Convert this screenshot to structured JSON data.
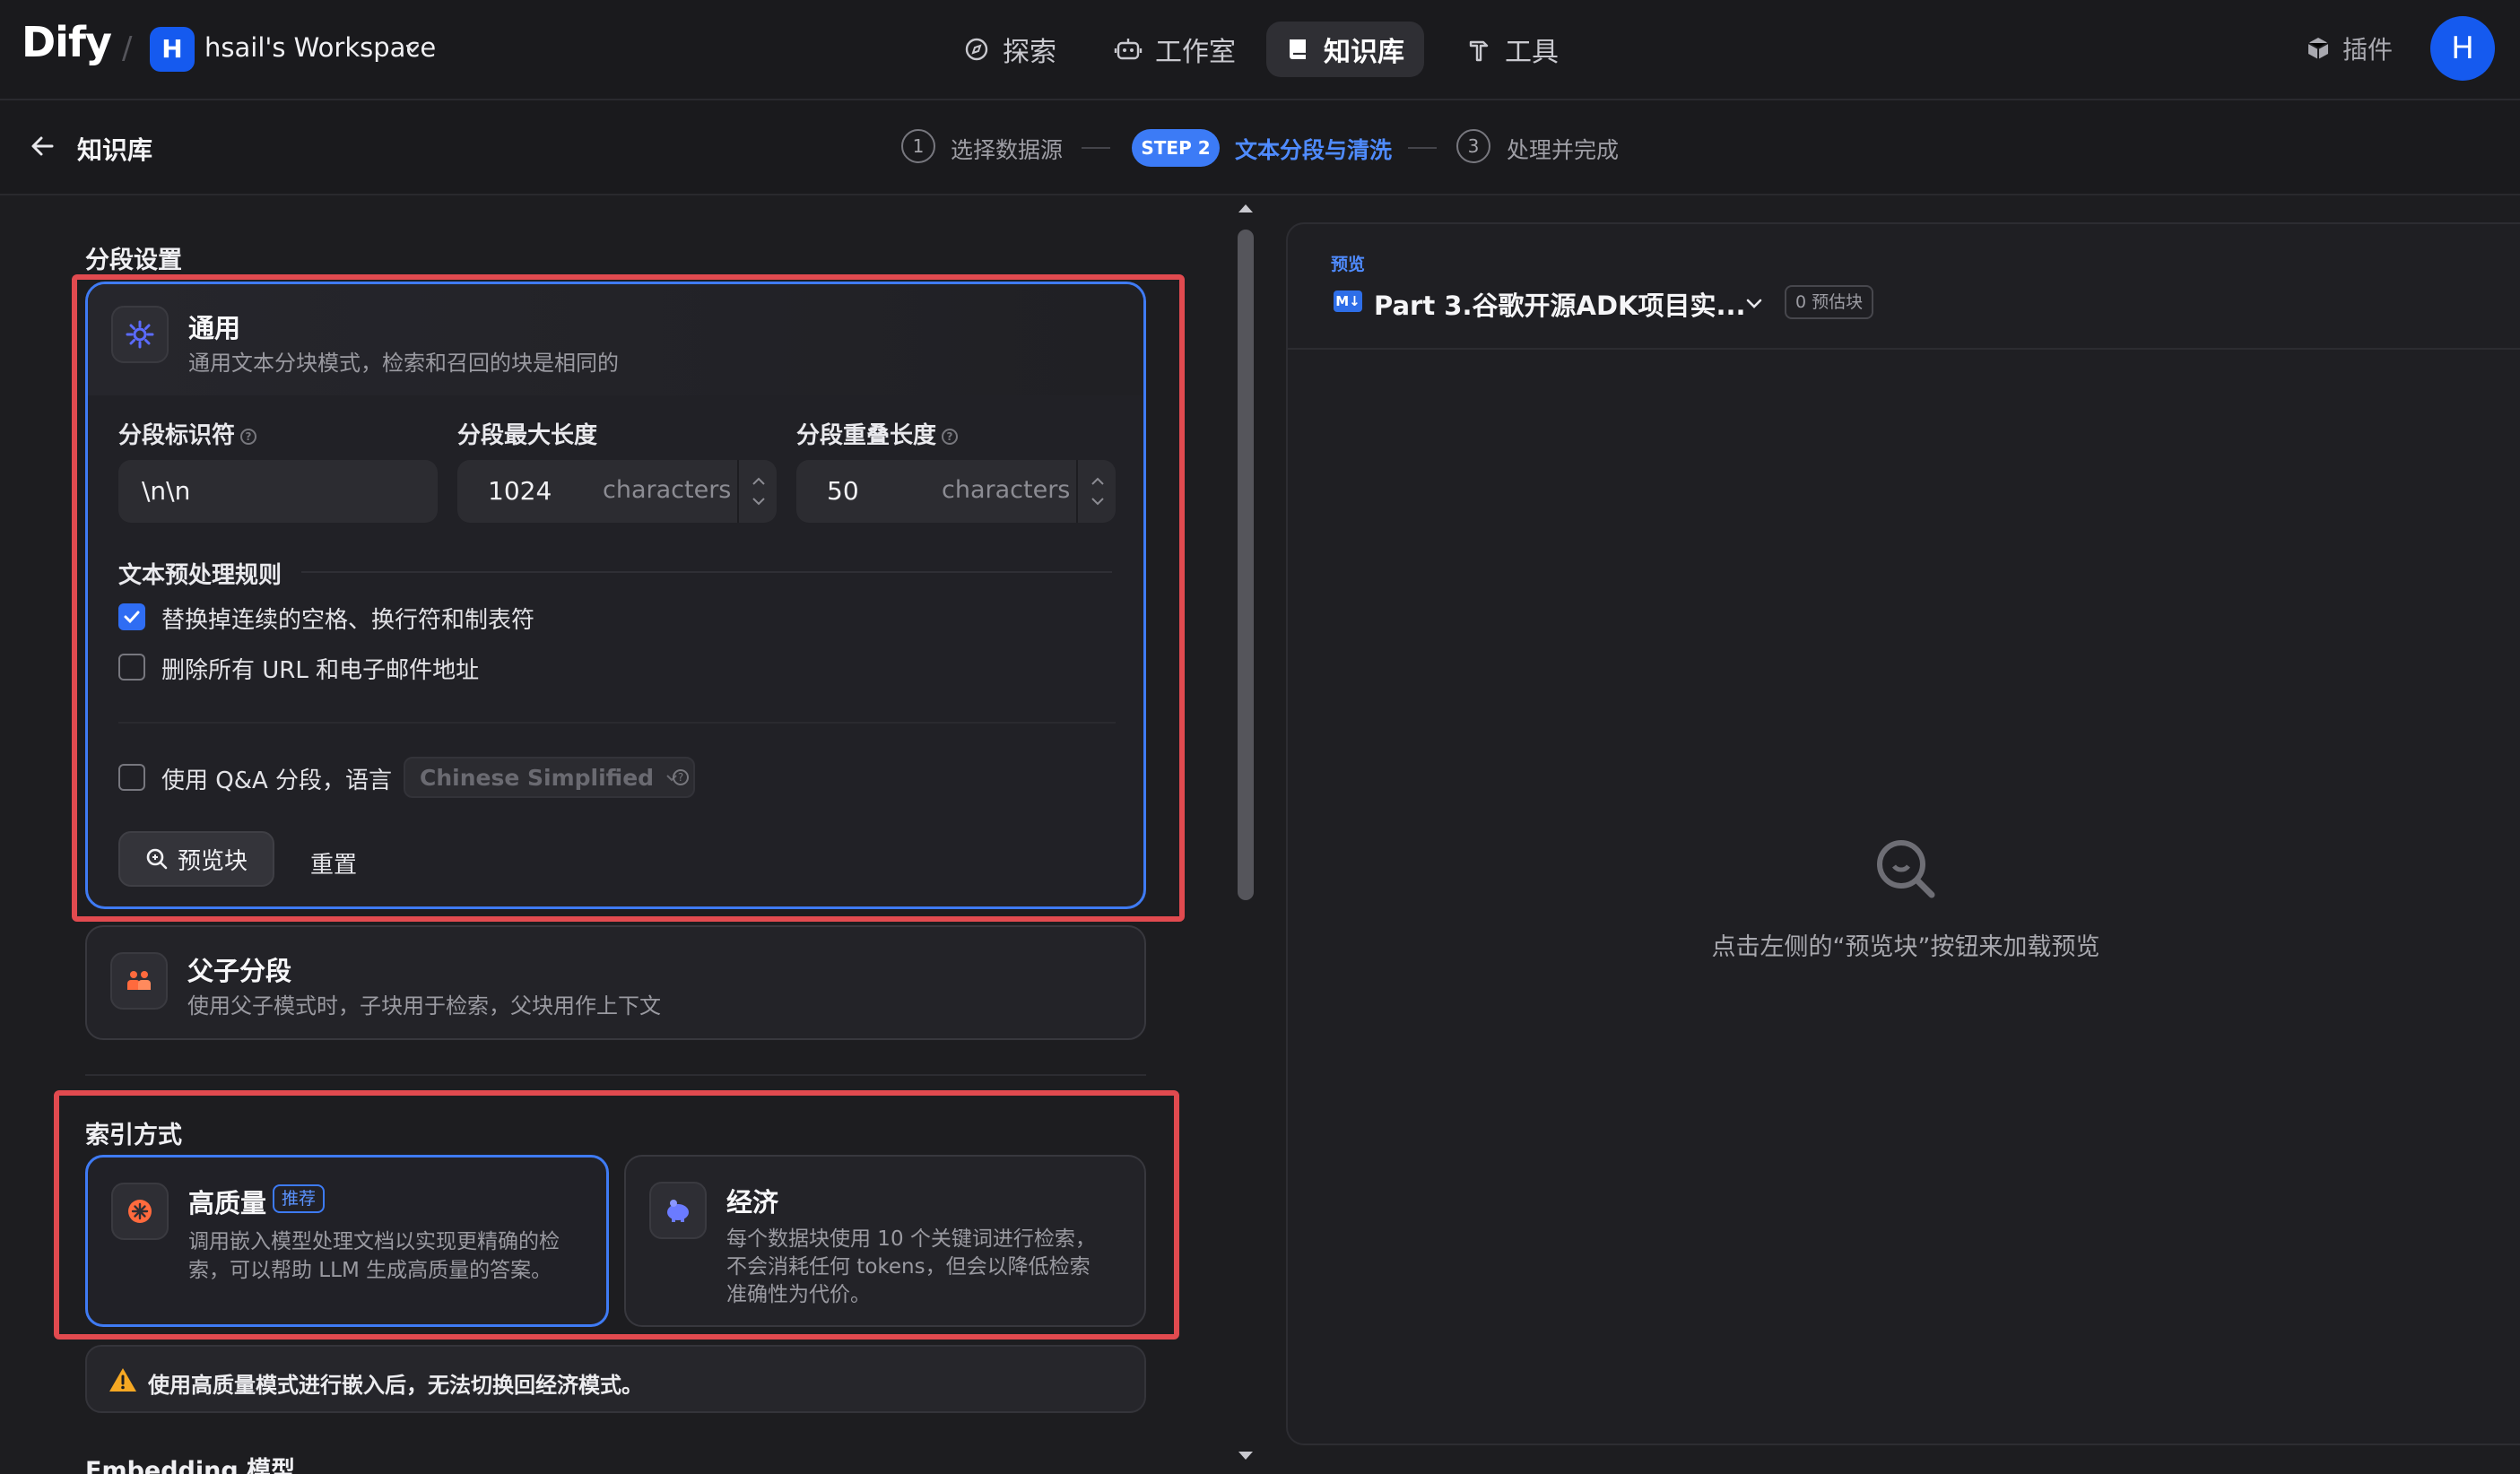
{
  "app": {
    "logo": "Dify"
  },
  "workspace": {
    "avatar": "H",
    "name": "hsail's Workspace"
  },
  "nav": [
    {
      "label": "探索",
      "icon": "compass-icon",
      "active": false
    },
    {
      "label": "工作室",
      "icon": "robot-icon",
      "active": false
    },
    {
      "label": "知识库",
      "icon": "book-icon",
      "active": true
    },
    {
      "label": "工具",
      "icon": "hammer-icon",
      "active": false
    }
  ],
  "plugin": {
    "label": "插件"
  },
  "user": {
    "avatar": "H"
  },
  "page": {
    "title": "知识库"
  },
  "steps": [
    {
      "num": "1",
      "label": "选择数据源"
    },
    {
      "num": "STEP 2",
      "label": "文本分段与清洗"
    },
    {
      "num": "3",
      "label": "处理并完成"
    }
  ],
  "segment": {
    "section_title": "分段设置",
    "general": {
      "title": "通用",
      "desc": "通用文本分块模式，检索和召回的块是相同的",
      "delimiter_label": "分段标识符",
      "delimiter_value": "\\n\\n",
      "max_length_label": "分段最大长度",
      "max_length_value": "1024",
      "overlap_label": "分段重叠长度",
      "overlap_value": "50",
      "unit": "characters",
      "rules_title": "文本预处理规则",
      "rule1": "替换掉连续的空格、换行符和制表符",
      "rule1_checked": true,
      "rule2": "删除所有 URL 和电子邮件地址",
      "rule2_checked": false,
      "qa_label": "使用 Q&A 分段，语言",
      "qa_checked": false,
      "qa_language": "Chinese Simplified",
      "preview_button": "预览块",
      "reset_button": "重置"
    },
    "parent_child": {
      "title": "父子分段",
      "desc": "使用父子模式时，子块用于检索，父块用作上下文"
    }
  },
  "index": {
    "section_title": "索引方式",
    "high_quality": {
      "title": "高质量",
      "badge": "推荐",
      "desc_line1": "调用嵌入模型处理文档以实现更精确的检",
      "desc_line2": "索，可以帮助 LLM 生成高质量的答案。"
    },
    "economy": {
      "title": "经济",
      "desc_line1": "每个数据块使用 10 个关键词进行检索，",
      "desc_line2": "不会消耗任何 tokens，但会以降低检索",
      "desc_line3": "准确性为代价。"
    },
    "warning": "使用高质量模式进行嵌入后，无法切换回经济模式。",
    "next_section": "Embedding 模型"
  },
  "preview": {
    "label": "预览",
    "doc_badge": "M↓",
    "doc_name": "Part 3.谷歌开源ADK项目实...",
    "count": "0 预估块",
    "empty_text": "点击左侧的“预览块”按钮来加载预览"
  },
  "colors": {
    "accent": "#3f7bf4",
    "highlight": "#e14a4f",
    "background": "#1d1d20"
  }
}
